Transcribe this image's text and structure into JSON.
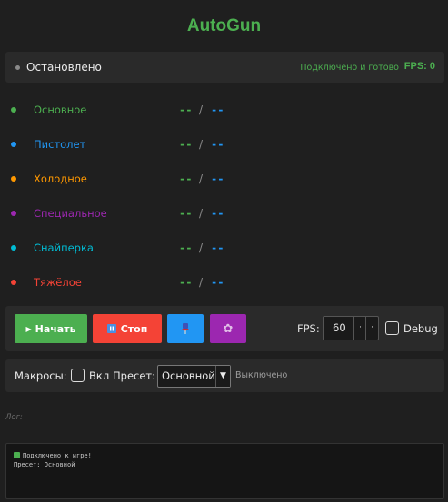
{
  "app": {
    "title": "AutoGun"
  },
  "status": {
    "state": "Остановлено",
    "connection": "Подключено и готово",
    "fps": "FPS: 0"
  },
  "weapons": [
    {
      "label": "Основное",
      "color": "#4caf50",
      "val1": "--",
      "sep": "/",
      "val2": "--"
    },
    {
      "label": "Пистолет",
      "color": "#2196f3",
      "val1": "--",
      "sep": "/",
      "val2": "--"
    },
    {
      "label": "Холодное",
      "color": "#ff9800",
      "val1": "--",
      "sep": "/",
      "val2": "--"
    },
    {
      "label": "Специальное",
      "color": "#9c27b0",
      "val1": "--",
      "sep": "/",
      "val2": "--"
    },
    {
      "label": "Снайперка",
      "color": "#00bcd4",
      "val1": "--",
      "sep": "/",
      "val2": "--"
    },
    {
      "label": "Тяжёлое",
      "color": "#f44336",
      "val1": "--",
      "sep": "/",
      "val2": "--"
    }
  ],
  "controls": {
    "start_label": "Начать",
    "stop_label": "Стоп",
    "fps_label": "FPS:",
    "fps_value": "60",
    "debug_label": "Debug",
    "debug_checked": false
  },
  "macros": {
    "label": "Макросы:",
    "enable_label": "Вкл",
    "enabled": false,
    "preset_label": "Пресет:",
    "preset_value": "Основной",
    "status": "Выключено"
  },
  "log": {
    "label": "Лог:",
    "lines": [
      "Подключено к игре!",
      "Пресет: Основной"
    ]
  },
  "colors": {
    "accent": "#4caf50",
    "start": "#4caf50",
    "stop": "#f44336",
    "blue": "#2196f3",
    "purple": "#9c27b0"
  }
}
